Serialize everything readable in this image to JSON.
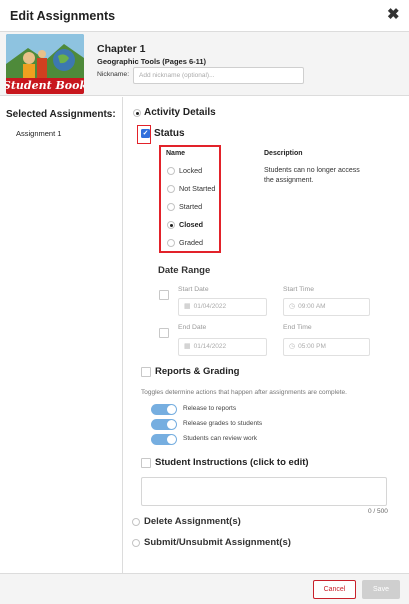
{
  "dialog": {
    "title": "Edit Assignments"
  },
  "book": {
    "cover_text": "Student Book",
    "chapter": "Chapter 1",
    "subtitle": "Geographic Tools (Pages 6-11)",
    "nickname_label": "Nickname:",
    "nickname_placeholder": "Add nickname (optional)..."
  },
  "sidebar": {
    "title": "Selected Assignments:",
    "items": [
      "Assignment 1"
    ]
  },
  "activity": {
    "label": "Activity Details",
    "selected": true
  },
  "status": {
    "label": "Status",
    "checked": true,
    "name_header": "Name",
    "description_header": "Description",
    "description_text": "Students can no longer access the assignment.",
    "options": [
      {
        "label": "Locked",
        "selected": false
      },
      {
        "label": "Not Started",
        "selected": false
      },
      {
        "label": "Started",
        "selected": false
      },
      {
        "label": "Closed",
        "selected": true
      },
      {
        "label": "Graded",
        "selected": false
      }
    ]
  },
  "date_range": {
    "title": "Date Range",
    "start_date_label": "Start Date",
    "start_date_value": "01/04/2022",
    "start_time_label": "Start Time",
    "start_time_value": "09:00 AM",
    "end_date_label": "End Date",
    "end_date_value": "01/14/2022",
    "end_time_label": "End Time",
    "end_time_value": "05:00 PM"
  },
  "reports": {
    "label": "Reports & Grading",
    "note": "Toggles determine actions that happen after assignments are complete.",
    "toggles": [
      {
        "label": "Release to reports",
        "on": true
      },
      {
        "label": "Release grades to students",
        "on": true
      },
      {
        "label": "Students can review work",
        "on": true
      }
    ]
  },
  "instructions": {
    "label": "Student Instructions (click to edit)",
    "counter": "0 / 500"
  },
  "delete": {
    "label": "Delete Assignment(s)"
  },
  "submit": {
    "label": "Submit/Unsubmit Assignment(s)"
  },
  "footer": {
    "cancel_label": "Cancel",
    "save_label": "Save"
  },
  "colors": {
    "accent_red": "#e2222a",
    "toggle_blue": "#76aee0",
    "check_blue": "#2f6fdc"
  }
}
